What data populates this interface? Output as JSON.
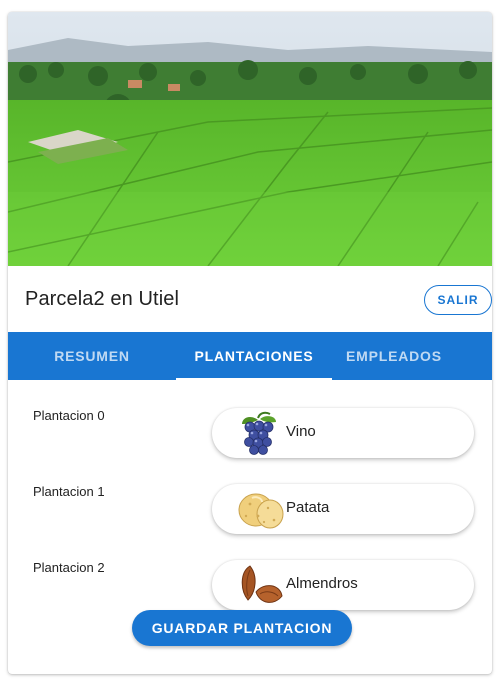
{
  "parcel": {
    "title": "Parcela2 en Utiel",
    "exit_label": "SALIR"
  },
  "tabs": [
    {
      "label": "RESUMEN",
      "active": false
    },
    {
      "label": "PLANTACIONES",
      "active": true
    },
    {
      "label": "EMPLEADOS",
      "active": false
    }
  ],
  "plantations": [
    {
      "label": "Plantacion 0",
      "crop": "Vino",
      "icon": "grapes-icon"
    },
    {
      "label": "Plantacion 1",
      "crop": "Patata",
      "icon": "potato-icon"
    },
    {
      "label": "Plantacion 2",
      "crop": "Almendros",
      "icon": "almond-icon"
    }
  ],
  "actions": {
    "save_label": "GUARDAR PLANTACION"
  },
  "colors": {
    "primary": "#1976d2",
    "field_green": "#5ec82a"
  }
}
